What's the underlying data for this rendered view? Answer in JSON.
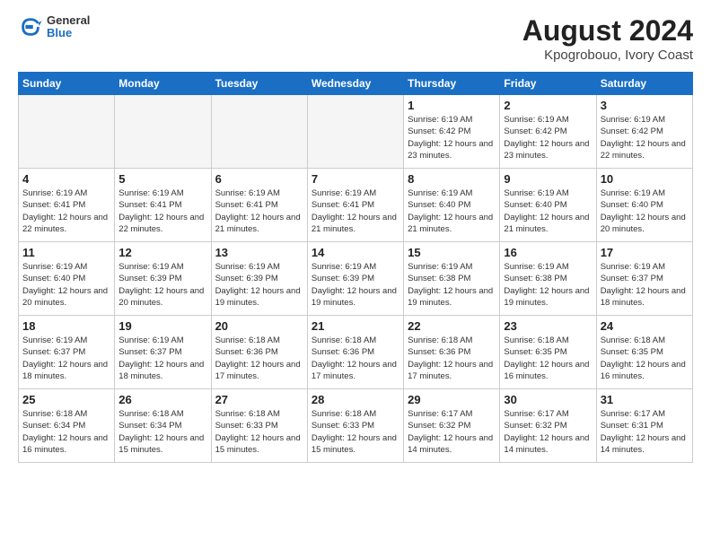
{
  "header": {
    "logo_general": "General",
    "logo_blue": "Blue",
    "month_title": "August 2024",
    "location": "Kpogrobouo, Ivory Coast"
  },
  "weekdays": [
    "Sunday",
    "Monday",
    "Tuesday",
    "Wednesday",
    "Thursday",
    "Friday",
    "Saturday"
  ],
  "weeks": [
    [
      {
        "day": "",
        "info": ""
      },
      {
        "day": "",
        "info": ""
      },
      {
        "day": "",
        "info": ""
      },
      {
        "day": "",
        "info": ""
      },
      {
        "day": "1",
        "info": "Sunrise: 6:19 AM\nSunset: 6:42 PM\nDaylight: 12 hours\nand 23 minutes."
      },
      {
        "day": "2",
        "info": "Sunrise: 6:19 AM\nSunset: 6:42 PM\nDaylight: 12 hours\nand 23 minutes."
      },
      {
        "day": "3",
        "info": "Sunrise: 6:19 AM\nSunset: 6:42 PM\nDaylight: 12 hours\nand 22 minutes."
      }
    ],
    [
      {
        "day": "4",
        "info": "Sunrise: 6:19 AM\nSunset: 6:41 PM\nDaylight: 12 hours\nand 22 minutes."
      },
      {
        "day": "5",
        "info": "Sunrise: 6:19 AM\nSunset: 6:41 PM\nDaylight: 12 hours\nand 22 minutes."
      },
      {
        "day": "6",
        "info": "Sunrise: 6:19 AM\nSunset: 6:41 PM\nDaylight: 12 hours\nand 21 minutes."
      },
      {
        "day": "7",
        "info": "Sunrise: 6:19 AM\nSunset: 6:41 PM\nDaylight: 12 hours\nand 21 minutes."
      },
      {
        "day": "8",
        "info": "Sunrise: 6:19 AM\nSunset: 6:40 PM\nDaylight: 12 hours\nand 21 minutes."
      },
      {
        "day": "9",
        "info": "Sunrise: 6:19 AM\nSunset: 6:40 PM\nDaylight: 12 hours\nand 21 minutes."
      },
      {
        "day": "10",
        "info": "Sunrise: 6:19 AM\nSunset: 6:40 PM\nDaylight: 12 hours\nand 20 minutes."
      }
    ],
    [
      {
        "day": "11",
        "info": "Sunrise: 6:19 AM\nSunset: 6:40 PM\nDaylight: 12 hours\nand 20 minutes."
      },
      {
        "day": "12",
        "info": "Sunrise: 6:19 AM\nSunset: 6:39 PM\nDaylight: 12 hours\nand 20 minutes."
      },
      {
        "day": "13",
        "info": "Sunrise: 6:19 AM\nSunset: 6:39 PM\nDaylight: 12 hours\nand 19 minutes."
      },
      {
        "day": "14",
        "info": "Sunrise: 6:19 AM\nSunset: 6:39 PM\nDaylight: 12 hours\nand 19 minutes."
      },
      {
        "day": "15",
        "info": "Sunrise: 6:19 AM\nSunset: 6:38 PM\nDaylight: 12 hours\nand 19 minutes."
      },
      {
        "day": "16",
        "info": "Sunrise: 6:19 AM\nSunset: 6:38 PM\nDaylight: 12 hours\nand 19 minutes."
      },
      {
        "day": "17",
        "info": "Sunrise: 6:19 AM\nSunset: 6:37 PM\nDaylight: 12 hours\nand 18 minutes."
      }
    ],
    [
      {
        "day": "18",
        "info": "Sunrise: 6:19 AM\nSunset: 6:37 PM\nDaylight: 12 hours\nand 18 minutes."
      },
      {
        "day": "19",
        "info": "Sunrise: 6:19 AM\nSunset: 6:37 PM\nDaylight: 12 hours\nand 18 minutes."
      },
      {
        "day": "20",
        "info": "Sunrise: 6:18 AM\nSunset: 6:36 PM\nDaylight: 12 hours\nand 17 minutes."
      },
      {
        "day": "21",
        "info": "Sunrise: 6:18 AM\nSunset: 6:36 PM\nDaylight: 12 hours\nand 17 minutes."
      },
      {
        "day": "22",
        "info": "Sunrise: 6:18 AM\nSunset: 6:36 PM\nDaylight: 12 hours\nand 17 minutes."
      },
      {
        "day": "23",
        "info": "Sunrise: 6:18 AM\nSunset: 6:35 PM\nDaylight: 12 hours\nand 16 minutes."
      },
      {
        "day": "24",
        "info": "Sunrise: 6:18 AM\nSunset: 6:35 PM\nDaylight: 12 hours\nand 16 minutes."
      }
    ],
    [
      {
        "day": "25",
        "info": "Sunrise: 6:18 AM\nSunset: 6:34 PM\nDaylight: 12 hours\nand 16 minutes."
      },
      {
        "day": "26",
        "info": "Sunrise: 6:18 AM\nSunset: 6:34 PM\nDaylight: 12 hours\nand 15 minutes."
      },
      {
        "day": "27",
        "info": "Sunrise: 6:18 AM\nSunset: 6:33 PM\nDaylight: 12 hours\nand 15 minutes."
      },
      {
        "day": "28",
        "info": "Sunrise: 6:18 AM\nSunset: 6:33 PM\nDaylight: 12 hours\nand 15 minutes."
      },
      {
        "day": "29",
        "info": "Sunrise: 6:17 AM\nSunset: 6:32 PM\nDaylight: 12 hours\nand 14 minutes."
      },
      {
        "day": "30",
        "info": "Sunrise: 6:17 AM\nSunset: 6:32 PM\nDaylight: 12 hours\nand 14 minutes."
      },
      {
        "day": "31",
        "info": "Sunrise: 6:17 AM\nSunset: 6:31 PM\nDaylight: 12 hours\nand 14 minutes."
      }
    ]
  ]
}
